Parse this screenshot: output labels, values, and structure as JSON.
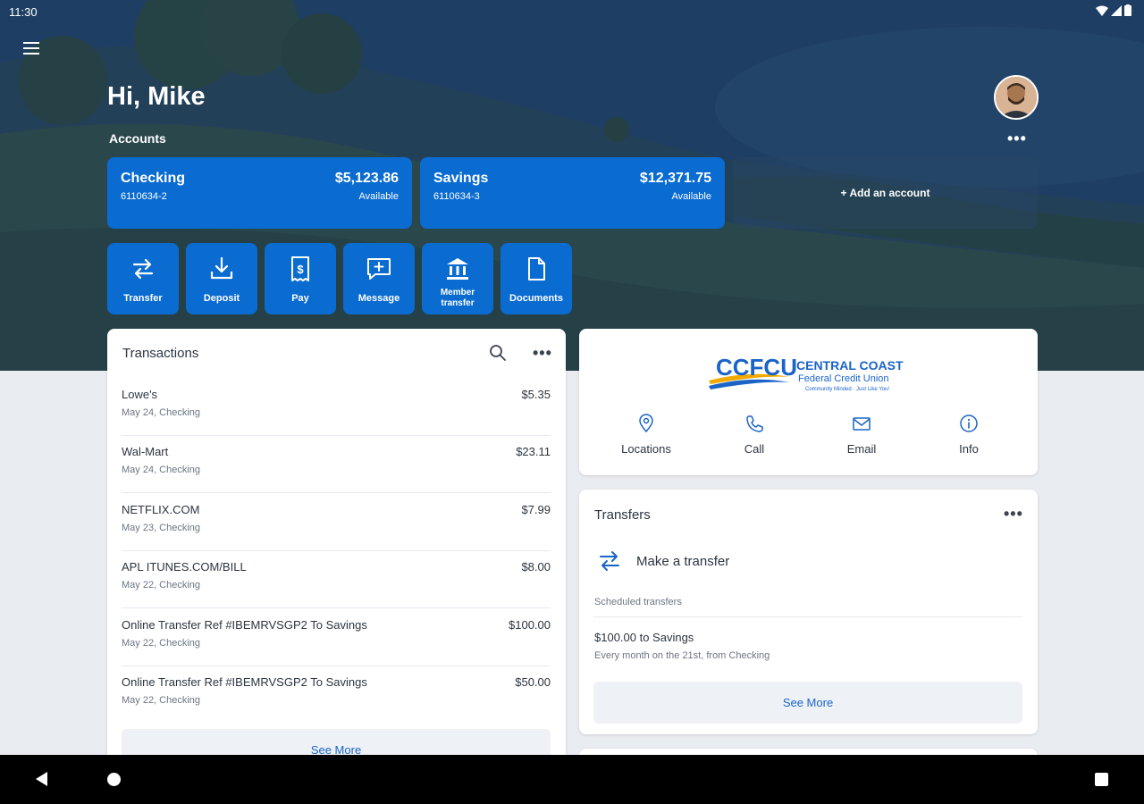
{
  "status_bar": {
    "time": "11:30"
  },
  "header": {
    "greeting": "Hi, Mike",
    "accounts_title": "Accounts",
    "more_dots": "•••"
  },
  "accounts": [
    {
      "name": "Checking",
      "number": "6110634-2",
      "balance": "$5,123.86",
      "balance_label": "Available"
    },
    {
      "name": "Savings",
      "number": "6110634-3",
      "balance": "$12,371.75",
      "balance_label": "Available"
    }
  ],
  "add_account_label": "+ Add an account",
  "actions": [
    {
      "label": "Transfer",
      "icon": "transfer-icon"
    },
    {
      "label": "Deposit",
      "icon": "download-icon"
    },
    {
      "label": "Pay",
      "icon": "bill-icon"
    },
    {
      "label": "Message",
      "icon": "message-icon"
    },
    {
      "label": "Member transfer",
      "icon": "bank-icon"
    },
    {
      "label": "Documents",
      "icon": "document-icon"
    }
  ],
  "transactions": {
    "title": "Transactions",
    "more_dots": "•••",
    "items": [
      {
        "description": "Lowe's",
        "detail": "May 24, Checking",
        "amount": "$5.35"
      },
      {
        "description": "Wal-Mart",
        "detail": "May 24, Checking",
        "amount": "$23.11"
      },
      {
        "description": "NETFLIX.COM",
        "detail": "May 23, Checking",
        "amount": "$7.99"
      },
      {
        "description": "APL ITUNES.COM/BILL",
        "detail": "May 22, Checking",
        "amount": "$8.00"
      },
      {
        "description": "Online Transfer Ref #IBEMRVSGP2 To Savings",
        "detail": "May 22, Checking",
        "amount": "$100.00"
      },
      {
        "description": "Online Transfer Ref #IBEMRVSGP2 To Savings",
        "detail": "May 22, Checking",
        "amount": "$50.00"
      }
    ],
    "see_more": "See More"
  },
  "credit_union": {
    "logo_initials": "CCFCU",
    "logo_name": "CENTRAL COAST",
    "logo_subname": "Federal Credit Union",
    "logo_tagline": "Community Minded · Just Like You!",
    "actions": [
      {
        "label": "Locations",
        "icon": "location-icon"
      },
      {
        "label": "Call",
        "icon": "phone-icon"
      },
      {
        "label": "Email",
        "icon": "email-icon"
      },
      {
        "label": "Info",
        "icon": "info-icon"
      }
    ]
  },
  "transfers": {
    "title": "Transfers",
    "more_dots": "•••",
    "make_transfer": "Make a transfer",
    "scheduled_label": "Scheduled transfers",
    "scheduled": [
      {
        "title": "$100.00 to Savings",
        "detail": "Every month on the 21st, from Checking"
      }
    ],
    "see_more": "See More"
  },
  "colors": {
    "primary_blue": "#0a6bd0",
    "link_blue": "#1a64c8",
    "hero_dark": "#1d3a5c",
    "background": "#e9ecf0"
  }
}
